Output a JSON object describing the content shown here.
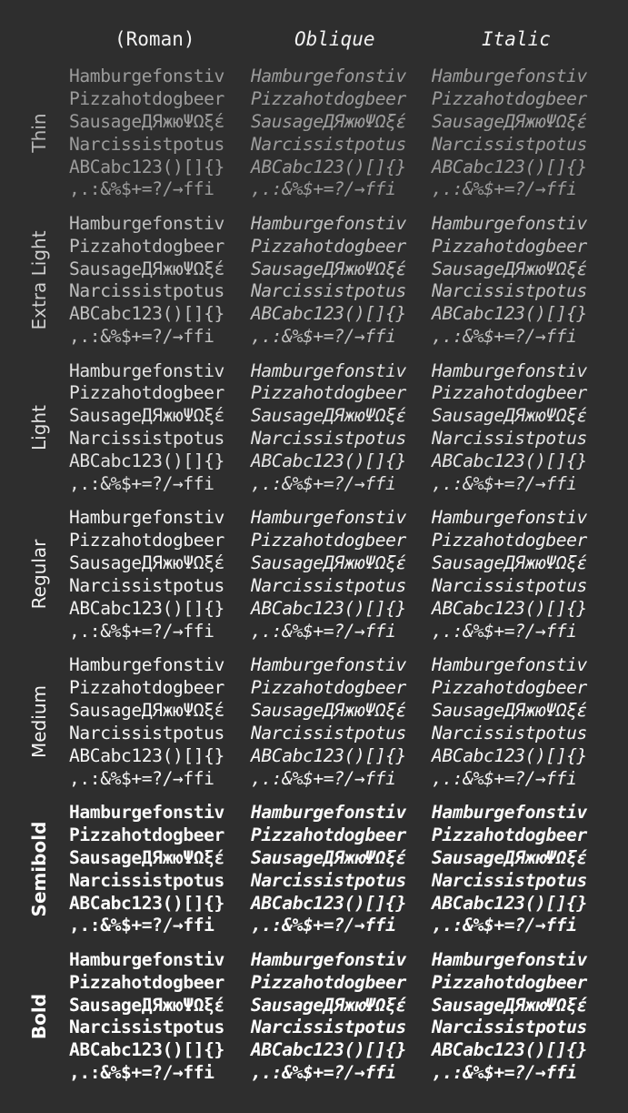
{
  "columns": [
    "(Roman)",
    "Oblique",
    "Italic"
  ],
  "sample_lines": [
    "Hamburgefonstiv",
    "Pizzahotdogbeer",
    "SausageДЯжюΨΩξέ",
    "Narcissistpotus",
    "ABCabc123()[]{}",
    ",.:&%$+=?/→ffi"
  ],
  "weights": [
    {
      "label": "Thin",
      "weight": 100,
      "color": "#b8b8b8"
    },
    {
      "label": "Extra Light",
      "weight": 200,
      "color": "#cfcfcf"
    },
    {
      "label": "Light",
      "weight": 300,
      "color": "#e2e2e2"
    },
    {
      "label": "Regular",
      "weight": 400,
      "color": "#f2f2f2"
    },
    {
      "label": "Medium",
      "weight": 500,
      "color": "#f6f6f6"
    },
    {
      "label": "Semibold",
      "weight": 600,
      "color": "#fafafa"
    },
    {
      "label": "Bold",
      "weight": 700,
      "color": "#ffffff"
    }
  ]
}
